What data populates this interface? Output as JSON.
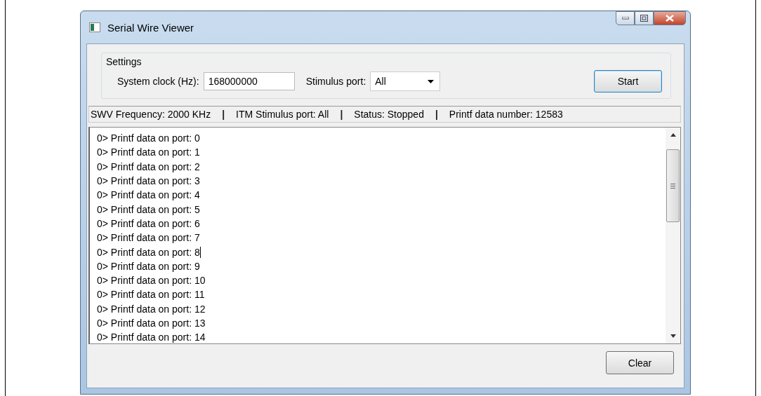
{
  "window": {
    "title": "Serial Wire Viewer"
  },
  "settings": {
    "title": "Settings",
    "system_clock": {
      "label": "System clock (Hz):",
      "value": "168000000"
    },
    "stimulus_port": {
      "label": "Stimulus port:",
      "value": "All"
    },
    "start_button": "Start"
  },
  "status_bar": [
    {
      "kind": "text",
      "text": "SWV Frequency: 2000 KHz"
    },
    {
      "kind": "separator",
      "text": "|"
    },
    {
      "kind": "text",
      "text": "ITM Stimulus port: All"
    },
    {
      "kind": "separator",
      "text": "|"
    },
    {
      "kind": "text",
      "text": "Status: Stopped"
    },
    {
      "kind": "separator",
      "text": "|"
    },
    {
      "kind": "text",
      "text": "Printf data number: 12583"
    }
  ],
  "log": [
    {
      "text": "0> Printf data on port: 0",
      "caret": false
    },
    {
      "text": "0> Printf data on port: 1",
      "caret": false
    },
    {
      "text": "0> Printf data on port: 2",
      "caret": false
    },
    {
      "text": "0> Printf data on port: 3",
      "caret": false
    },
    {
      "text": "0> Printf data on port: 4",
      "caret": false
    },
    {
      "text": "0> Printf data on port: 5",
      "caret": false
    },
    {
      "text": "0> Printf data on port: 6",
      "caret": false
    },
    {
      "text": "0> Printf data on port: 7",
      "caret": false
    },
    {
      "text": "0> Printf data on port: 8",
      "caret": true
    },
    {
      "text": "0> Printf data on port: 9",
      "caret": false
    },
    {
      "text": "0> Printf data on port: 10",
      "caret": false
    },
    {
      "text": "0> Printf data on port: 11",
      "caret": false
    },
    {
      "text": "0> Printf data on port: 12",
      "caret": false
    },
    {
      "text": "0> Printf data on port: 13",
      "caret": false
    },
    {
      "text": "0> Printf data on port: 14",
      "caret": false
    }
  ],
  "clear_button": "Clear"
}
